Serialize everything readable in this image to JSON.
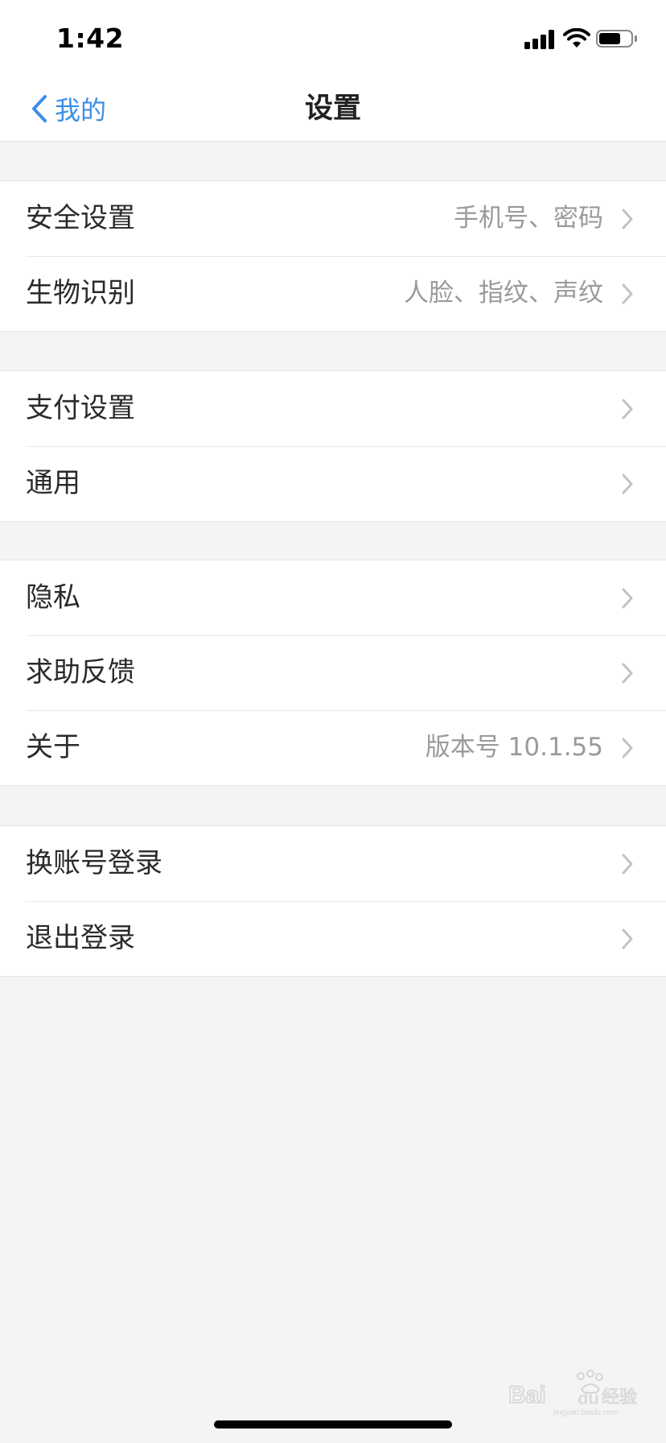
{
  "status_bar": {
    "time": "1:42"
  },
  "nav": {
    "back_label": "我的",
    "title": "设置",
    "accent_color": "#3d8ee8"
  },
  "groups": [
    {
      "rows": [
        {
          "label": "安全设置",
          "value": "手机号、密码"
        },
        {
          "label": "生物识别",
          "value": "人脸、指纹、声纹"
        }
      ]
    },
    {
      "rows": [
        {
          "label": "支付设置",
          "value": ""
        },
        {
          "label": "通用",
          "value": ""
        }
      ]
    },
    {
      "rows": [
        {
          "label": "隐私",
          "value": ""
        },
        {
          "label": "求助反馈",
          "value": ""
        },
        {
          "label": "关于",
          "value": "版本号 10.1.55"
        }
      ]
    },
    {
      "rows": [
        {
          "label": "换账号登录",
          "value": ""
        },
        {
          "label": "退出登录",
          "value": ""
        }
      ]
    }
  ],
  "watermark": {
    "text": "Baidu经验",
    "subtext": "jingyan.baidu.com"
  }
}
